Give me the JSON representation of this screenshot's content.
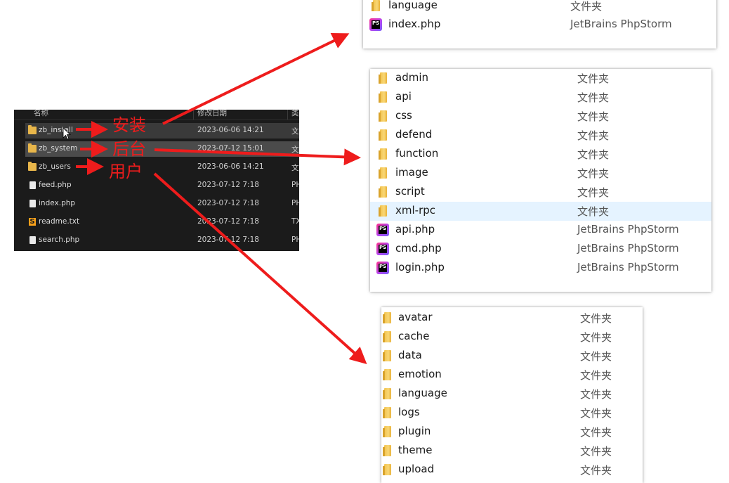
{
  "dark_explorer": {
    "headers": [
      "名称",
      "修改日期",
      "类"
    ],
    "rows": [
      {
        "name": "zb_install",
        "date": "2023-06-06 14:21",
        "type": "文",
        "icon": "folder-icon",
        "state": "hover"
      },
      {
        "name": "zb_system",
        "date": "2023-07-12 15:01",
        "type": "文",
        "icon": "folder-icon",
        "state": "selected"
      },
      {
        "name": "zb_users",
        "date": "2023-06-06 14:21",
        "type": "文",
        "icon": "folder-icon",
        "state": "normal"
      },
      {
        "name": "feed.php",
        "date": "2023-07-12 7:18",
        "type": "PH",
        "icon": "file-icon",
        "state": "normal"
      },
      {
        "name": "index.php",
        "date": "2023-07-12 7:18",
        "type": "PH",
        "icon": "file-icon",
        "state": "normal"
      },
      {
        "name": "readme.txt",
        "date": "2023-07-12 7:18",
        "type": "TX",
        "icon": "sublime-text-icon",
        "state": "normal"
      },
      {
        "name": "search.php",
        "date": "2023-07-12 7:18",
        "type": "PH",
        "icon": "file-icon",
        "state": "normal"
      }
    ]
  },
  "annotations": {
    "install": "安装",
    "backend": "后台",
    "users": "用户"
  },
  "install_panel": {
    "rows": [
      {
        "name": "language",
        "type": "文件夹",
        "icon": "folder-icon"
      },
      {
        "name": "index.php",
        "type": "JetBrains PhpStorm",
        "icon": "phpstorm-icon"
      }
    ]
  },
  "system_panel": {
    "rows": [
      {
        "name": "admin",
        "type": "文件夹",
        "icon": "folder-icon"
      },
      {
        "name": "api",
        "type": "文件夹",
        "icon": "folder-icon"
      },
      {
        "name": "css",
        "type": "文件夹",
        "icon": "folder-icon"
      },
      {
        "name": "defend",
        "type": "文件夹",
        "icon": "folder-icon"
      },
      {
        "name": "function",
        "type": "文件夹",
        "icon": "folder-icon"
      },
      {
        "name": "image",
        "type": "文件夹",
        "icon": "folder-icon"
      },
      {
        "name": "script",
        "type": "文件夹",
        "icon": "folder-icon"
      },
      {
        "name": "xml-rpc",
        "type": "文件夹",
        "icon": "folder-icon",
        "highlighted": true
      },
      {
        "name": "api.php",
        "type": "JetBrains PhpStorm",
        "icon": "phpstorm-icon"
      },
      {
        "name": "cmd.php",
        "type": "JetBrains PhpStorm",
        "icon": "phpstorm-icon"
      },
      {
        "name": "login.php",
        "type": "JetBrains PhpStorm",
        "icon": "phpstorm-icon"
      }
    ]
  },
  "users_panel": {
    "rows": [
      {
        "name": "avatar",
        "type": "文件夹",
        "icon": "folder-icon"
      },
      {
        "name": "cache",
        "type": "文件夹",
        "icon": "folder-icon"
      },
      {
        "name": "data",
        "type": "文件夹",
        "icon": "folder-icon"
      },
      {
        "name": "emotion",
        "type": "文件夹",
        "icon": "folder-icon"
      },
      {
        "name": "language",
        "type": "文件夹",
        "icon": "folder-icon"
      },
      {
        "name": "logs",
        "type": "文件夹",
        "icon": "folder-icon"
      },
      {
        "name": "plugin",
        "type": "文件夹",
        "icon": "folder-icon"
      },
      {
        "name": "theme",
        "type": "文件夹",
        "icon": "folder-icon"
      },
      {
        "name": "upload",
        "type": "文件夹",
        "icon": "folder-icon"
      }
    ]
  },
  "colors": {
    "annotation": "#ee1c1c",
    "dark_bg": "#1b1b1b",
    "selected_row": "#e5f3ff"
  }
}
